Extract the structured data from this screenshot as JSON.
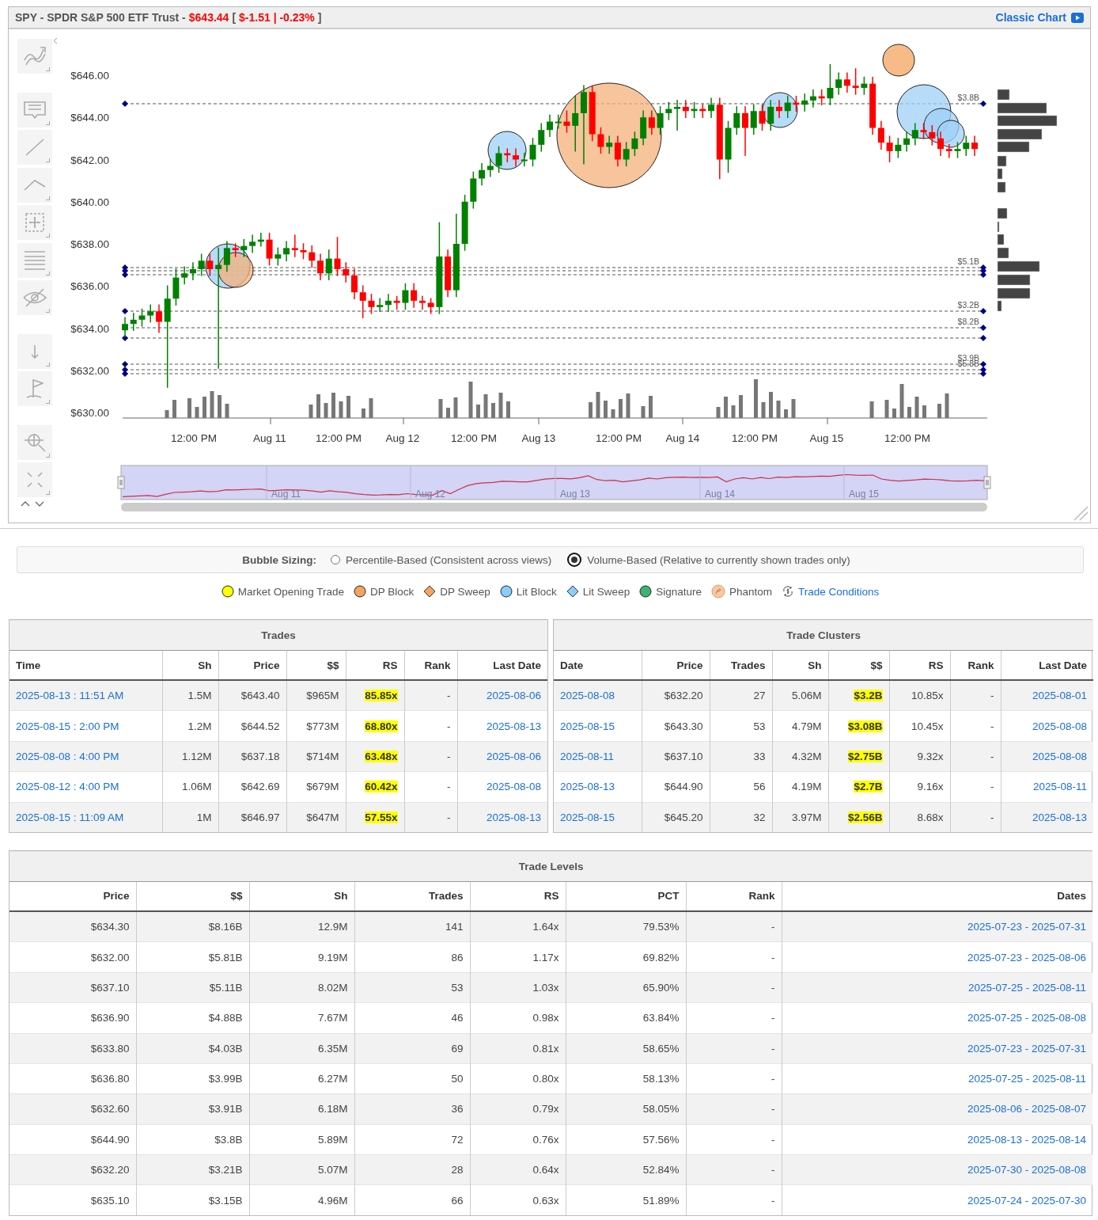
{
  "chart": {
    "title": [
      {
        "text": "SPY - SPDR S&P 500 ETF Trust -",
        "color": "#555555"
      },
      {
        "text": "$643.44",
        "color": "#ff0000"
      },
      {
        "text": "[",
        "color": "#555555"
      },
      {
        "text": "$-1.51 | -0.23%",
        "color": "#ff0000"
      },
      {
        "text": "]",
        "color": "#555555"
      }
    ],
    "classic_link": "Classic Chart",
    "chart_data": {
      "type": "candlestick",
      "yticks": [
        {
          "value": 646,
          "label": "$646.00"
        },
        {
          "value": 644,
          "label": "$644.00"
        },
        {
          "value": 642,
          "label": "$642.00"
        },
        {
          "value": 640,
          "label": "$640.00"
        },
        {
          "value": 638,
          "label": "$638.00"
        },
        {
          "value": 636,
          "label": "$636.00"
        },
        {
          "value": 634,
          "label": "$634.00"
        },
        {
          "value": 632,
          "label": "$632.00"
        },
        {
          "value": 630,
          "label": "$630.00"
        }
      ],
      "ylim": [
        630,
        646
      ],
      "ohlc": [
        [
          633.9,
          634.5,
          633.6,
          634.2
        ],
        [
          634.2,
          634.7,
          633.9,
          634.4
        ],
        [
          634.4,
          634.9,
          634.1,
          634.6
        ],
        [
          634.6,
          635.1,
          634.3,
          634.8
        ],
        [
          634.8,
          635.1,
          633.8,
          634.3
        ],
        [
          634.3,
          636.0,
          631.2,
          635.4
        ],
        [
          635.4,
          636.8,
          635.1,
          636.4
        ],
        [
          636.4,
          636.9,
          636.1,
          636.6
        ],
        [
          636.6,
          637.1,
          636.3,
          636.8
        ],
        [
          636.8,
          637.5,
          636.5,
          637.2
        ],
        [
          637.2,
          637.5,
          636.5,
          636.8
        ],
        [
          636.8,
          637.8,
          632.1,
          637.0
        ],
        [
          637.0,
          638.1,
          636.7,
          637.8
        ],
        [
          637.8,
          638.0,
          637.4,
          637.7
        ],
        [
          637.7,
          638.2,
          637.4,
          637.9
        ],
        [
          637.9,
          638.4,
          637.6,
          638.1
        ],
        [
          638.1,
          638.5,
          637.9,
          638.2
        ],
        [
          638.2,
          638.5,
          637.0,
          637.3
        ],
        [
          637.3,
          637.8,
          637.0,
          637.5
        ],
        [
          637.5,
          638.1,
          637.2,
          637.8
        ],
        [
          637.8,
          638.4,
          637.4,
          637.7
        ],
        [
          637.7,
          638.0,
          637.3,
          637.6
        ],
        [
          637.6,
          637.9,
          636.9,
          637.2
        ],
        [
          637.2,
          637.5,
          636.3,
          636.6
        ],
        [
          636.6,
          637.7,
          636.3,
          637.3
        ],
        [
          637.3,
          638.3,
          636.5,
          636.8
        ],
        [
          636.8,
          637.1,
          636.2,
          636.5
        ],
        [
          636.5,
          636.8,
          635.4,
          635.7
        ],
        [
          635.7,
          636.0,
          634.5,
          635.3
        ],
        [
          635.3,
          635.6,
          634.7,
          635.0
        ],
        [
          635.0,
          635.4,
          634.8,
          635.1
        ],
        [
          635.1,
          635.6,
          634.8,
          635.3
        ],
        [
          635.3,
          635.5,
          634.9,
          635.2
        ],
        [
          635.2,
          636.1,
          634.9,
          635.8
        ],
        [
          635.8,
          636.1,
          635.0,
          635.3
        ],
        [
          635.3,
          635.5,
          634.9,
          635.2
        ],
        [
          635.2,
          635.4,
          634.7,
          635.0
        ],
        [
          635.0,
          639.0,
          634.7,
          637.4
        ],
        [
          637.4,
          637.7,
          635.5,
          635.8
        ],
        [
          635.8,
          639.4,
          635.5,
          638.0
        ],
        [
          638.0,
          640.3,
          637.7,
          640.0
        ],
        [
          640.0,
          641.4,
          639.7,
          641.1
        ],
        [
          641.1,
          641.8,
          640.8,
          641.5
        ],
        [
          641.5,
          642.0,
          641.2,
          641.7
        ],
        [
          641.7,
          642.6,
          641.4,
          642.3
        ],
        [
          642.3,
          642.5,
          641.9,
          642.2
        ],
        [
          642.2,
          642.5,
          641.7,
          642.0
        ],
        [
          642.0,
          642.3,
          641.7,
          642.0
        ],
        [
          642.0,
          643.0,
          641.7,
          642.7
        ],
        [
          642.7,
          643.7,
          642.4,
          643.4
        ],
        [
          643.4,
          644.1,
          643.1,
          643.8
        ],
        [
          643.8,
          644.1,
          643.5,
          643.8
        ],
        [
          643.8,
          644.3,
          643.3,
          643.6
        ],
        [
          643.6,
          645.0,
          642.4,
          644.2
        ],
        [
          644.2,
          645.5,
          641.8,
          645.2
        ],
        [
          645.2,
          645.5,
          642.9,
          643.2
        ],
        [
          643.2,
          643.5,
          642.3,
          642.6
        ],
        [
          642.6,
          643.1,
          642.3,
          642.8
        ],
        [
          642.8,
          643.1,
          641.7,
          642.0
        ],
        [
          642.0,
          642.8,
          641.7,
          642.5
        ],
        [
          642.5,
          643.3,
          642.2,
          643.0
        ],
        [
          643.0,
          644.3,
          642.7,
          644.0
        ],
        [
          644.0,
          644.3,
          643.2,
          643.5
        ],
        [
          643.5,
          644.5,
          643.2,
          644.2
        ],
        [
          644.2,
          644.7,
          643.9,
          644.4
        ],
        [
          644.4,
          644.8,
          643.4,
          644.5
        ],
        [
          644.5,
          644.8,
          644.0,
          644.3
        ],
        [
          644.3,
          644.7,
          644.0,
          644.4
        ],
        [
          644.4,
          644.6,
          644.0,
          644.3
        ],
        [
          644.3,
          644.9,
          644.0,
          644.6
        ],
        [
          644.6,
          644.9,
          641.1,
          642.0
        ],
        [
          642.0,
          643.8,
          641.4,
          643.5
        ],
        [
          643.5,
          644.5,
          643.2,
          644.2
        ],
        [
          644.2,
          644.5,
          642.2,
          643.5
        ],
        [
          643.5,
          644.6,
          643.2,
          644.3
        ],
        [
          644.3,
          644.6,
          643.4,
          643.7
        ],
        [
          643.7,
          644.8,
          643.4,
          644.5
        ],
        [
          644.5,
          644.8,
          644.0,
          644.3
        ],
        [
          644.3,
          645.0,
          644.0,
          644.7
        ],
        [
          644.7,
          645.0,
          644.3,
          644.6
        ],
        [
          644.6,
          645.1,
          644.3,
          644.8
        ],
        [
          644.8,
          645.3,
          644.5,
          645.0
        ],
        [
          645.0,
          645.3,
          644.6,
          644.9
        ],
        [
          644.9,
          646.5,
          644.6,
          645.4
        ],
        [
          645.4,
          646.1,
          645.1,
          645.8
        ],
        [
          645.8,
          646.1,
          645.2,
          645.5
        ],
        [
          645.5,
          646.3,
          645.1,
          645.4
        ],
        [
          645.4,
          645.9,
          645.1,
          645.6
        ],
        [
          645.6,
          645.9,
          643.2,
          643.5
        ],
        [
          643.5,
          643.8,
          642.5,
          642.8
        ],
        [
          642.8,
          643.1,
          641.9,
          642.4
        ],
        [
          642.4,
          643.0,
          642.1,
          642.7
        ],
        [
          642.7,
          643.3,
          642.4,
          643.0
        ],
        [
          643.0,
          643.7,
          642.7,
          643.4
        ],
        [
          643.4,
          643.7,
          643.0,
          643.3
        ],
        [
          643.3,
          643.6,
          642.7,
          643.0
        ],
        [
          643.0,
          643.3,
          642.2,
          642.5
        ],
        [
          642.5,
          642.7,
          642.1,
          642.4
        ],
        [
          642.4,
          642.8,
          642.1,
          642.5
        ],
        [
          642.5,
          643.1,
          642.2,
          642.8
        ],
        [
          642.8,
          643.1,
          642.2,
          642.5
        ]
      ]
    },
    "level_labels": [
      "$3.8B",
      "$5.1B",
      "$3.2B",
      "$8.2B",
      "$3.9B",
      "$5.8B"
    ],
    "x_labels": [
      "12:00 PM",
      "Aug 11",
      "12:00 PM",
      "Aug 12",
      "12:00 PM",
      "Aug 13",
      "12:00 PM",
      "Aug 14",
      "12:00 PM",
      "Aug 15",
      "12:00 PM"
    ],
    "navigator_labels": [
      "Aug 11",
      "Aug 12",
      "Aug 13",
      "Aug 14",
      "Aug 15"
    ]
  },
  "bubble_sizing": {
    "label": "Bubble Sizing:",
    "options": [
      {
        "label": "Percentile-Based (Consistent across views)",
        "selected": false
      },
      {
        "label": "Volume-Based (Relative to currently shown trades only)",
        "selected": true
      }
    ]
  },
  "legend": [
    {
      "kind": "circle",
      "label": "Market Opening Trade",
      "color": "#ffff00"
    },
    {
      "kind": "circle",
      "label": "DP Block",
      "color": "#f4a460"
    },
    {
      "kind": "diamond",
      "label": "DP Sweep",
      "color": "#f4a460"
    },
    {
      "kind": "circle",
      "label": "Lit Block",
      "color": "#87cefa"
    },
    {
      "kind": "diamond",
      "label": "Lit Sweep",
      "color": "#87cefa"
    },
    {
      "kind": "circle",
      "label": "Signature",
      "color": "#3cb371"
    },
    {
      "kind": "phantom",
      "label": "Phantom",
      "color": "#f8c9a0"
    },
    {
      "kind": "link",
      "label": "Trade Conditions"
    }
  ],
  "tables": [
    {
      "title": "Trades",
      "columns": [
        {
          "label": "Time",
          "link": true,
          "highlight": false
        },
        {
          "label": "Sh",
          "link": false,
          "highlight": false
        },
        {
          "label": "Price",
          "link": false,
          "highlight": false
        },
        {
          "label": "$$",
          "link": false,
          "highlight": false
        },
        {
          "label": "RS",
          "link": false,
          "highlight": true
        },
        {
          "label": "Rank",
          "link": false,
          "highlight": false
        },
        {
          "label": "Last Date",
          "link": true,
          "highlight": false
        }
      ],
      "rows": [
        [
          "2025-08-13 : 11:51 AM",
          "1.5M",
          "$643.40",
          "$965M",
          "85.85x",
          "-",
          "2025-08-06"
        ],
        [
          "2025-08-15 : 2:00 PM",
          "1.2M",
          "$644.52",
          "$773M",
          "68.80x",
          "-",
          "2025-08-13"
        ],
        [
          "2025-08-08 : 4:00 PM",
          "1.12M",
          "$637.18",
          "$714M",
          "63.48x",
          "-",
          "2025-08-06"
        ],
        [
          "2025-08-12 : 4:00 PM",
          "1.06M",
          "$642.69",
          "$679M",
          "60.42x",
          "-",
          "2025-08-08"
        ],
        [
          "2025-08-15 : 11:09 AM",
          "1M",
          "$646.97",
          "$647M",
          "57.55x",
          "-",
          "2025-08-13"
        ]
      ]
    },
    {
      "title": "Trade Clusters",
      "columns": [
        {
          "label": "Date",
          "link": true,
          "highlight": false
        },
        {
          "label": "Price",
          "link": false,
          "highlight": false
        },
        {
          "label": "Trades",
          "link": false,
          "highlight": false
        },
        {
          "label": "Sh",
          "link": false,
          "highlight": false
        },
        {
          "label": "$$",
          "link": false,
          "highlight": true
        },
        {
          "label": "RS",
          "link": false,
          "highlight": false
        },
        {
          "label": "Rank",
          "link": false,
          "highlight": false
        },
        {
          "label": "Last Date",
          "link": true,
          "highlight": false
        }
      ],
      "rows": [
        [
          "2025-08-08",
          "$632.20",
          "27",
          "5.06M",
          "$3.2B",
          "10.85x",
          "-",
          "2025-08-01"
        ],
        [
          "2025-08-15",
          "$643.30",
          "53",
          "4.79M",
          "$3.08B",
          "10.45x",
          "-",
          "2025-08-08"
        ],
        [
          "2025-08-11",
          "$637.10",
          "33",
          "4.32M",
          "$2.75B",
          "9.32x",
          "-",
          "2025-08-08"
        ],
        [
          "2025-08-13",
          "$644.90",
          "56",
          "4.19M",
          "$2.7B",
          "9.16x",
          "-",
          "2025-08-11"
        ],
        [
          "2025-08-15",
          "$645.20",
          "32",
          "3.97M",
          "$2.56B",
          "8.68x",
          "-",
          "2025-08-13"
        ]
      ]
    },
    {
      "title": "Trade Levels",
      "columns": [
        {
          "label": "Price",
          "link": false,
          "highlight": false
        },
        {
          "label": "$$",
          "link": false,
          "highlight": false
        },
        {
          "label": "Sh",
          "link": false,
          "highlight": false
        },
        {
          "label": "Trades",
          "link": false,
          "highlight": false
        },
        {
          "label": "RS",
          "link": false,
          "highlight": false
        },
        {
          "label": "PCT",
          "link": false,
          "highlight": false
        },
        {
          "label": "Rank",
          "link": false,
          "highlight": false
        },
        {
          "label": "Dates",
          "link": true,
          "highlight": false
        }
      ],
      "rows": [
        [
          "$634.30",
          "$8.16B",
          "12.9M",
          "141",
          "1.64x",
          "79.53%",
          "-",
          "2025-07-23 - 2025-07-31"
        ],
        [
          "$632.00",
          "$5.81B",
          "9.19M",
          "86",
          "1.17x",
          "69.82%",
          "-",
          "2025-07-23 - 2025-08-06"
        ],
        [
          "$637.10",
          "$5.11B",
          "8.02M",
          "53",
          "1.03x",
          "65.90%",
          "-",
          "2025-07-25 - 2025-08-11"
        ],
        [
          "$636.90",
          "$4.88B",
          "7.67M",
          "46",
          "0.98x",
          "63.84%",
          "-",
          "2025-07-25 - 2025-08-08"
        ],
        [
          "$633.80",
          "$4.03B",
          "6.35M",
          "69",
          "0.81x",
          "58.65%",
          "-",
          "2025-07-23 - 2025-07-31"
        ],
        [
          "$636.80",
          "$3.99B",
          "6.27M",
          "50",
          "0.80x",
          "58.13%",
          "-",
          "2025-07-25 - 2025-08-11"
        ],
        [
          "$632.60",
          "$3.91B",
          "6.18M",
          "36",
          "0.79x",
          "58.05%",
          "-",
          "2025-08-06 - 2025-08-07"
        ],
        [
          "$644.90",
          "$3.8B",
          "5.89M",
          "72",
          "0.76x",
          "57.56%",
          "-",
          "2025-08-13 - 2025-08-14"
        ],
        [
          "$632.20",
          "$3.21B",
          "5.07M",
          "28",
          "0.64x",
          "52.84%",
          "-",
          "2025-07-30 - 2025-08-08"
        ],
        [
          "$635.10",
          "$3.15B",
          "4.96M",
          "66",
          "0.63x",
          "51.89%",
          "-",
          "2025-07-24 - 2025-07-30"
        ]
      ]
    }
  ]
}
